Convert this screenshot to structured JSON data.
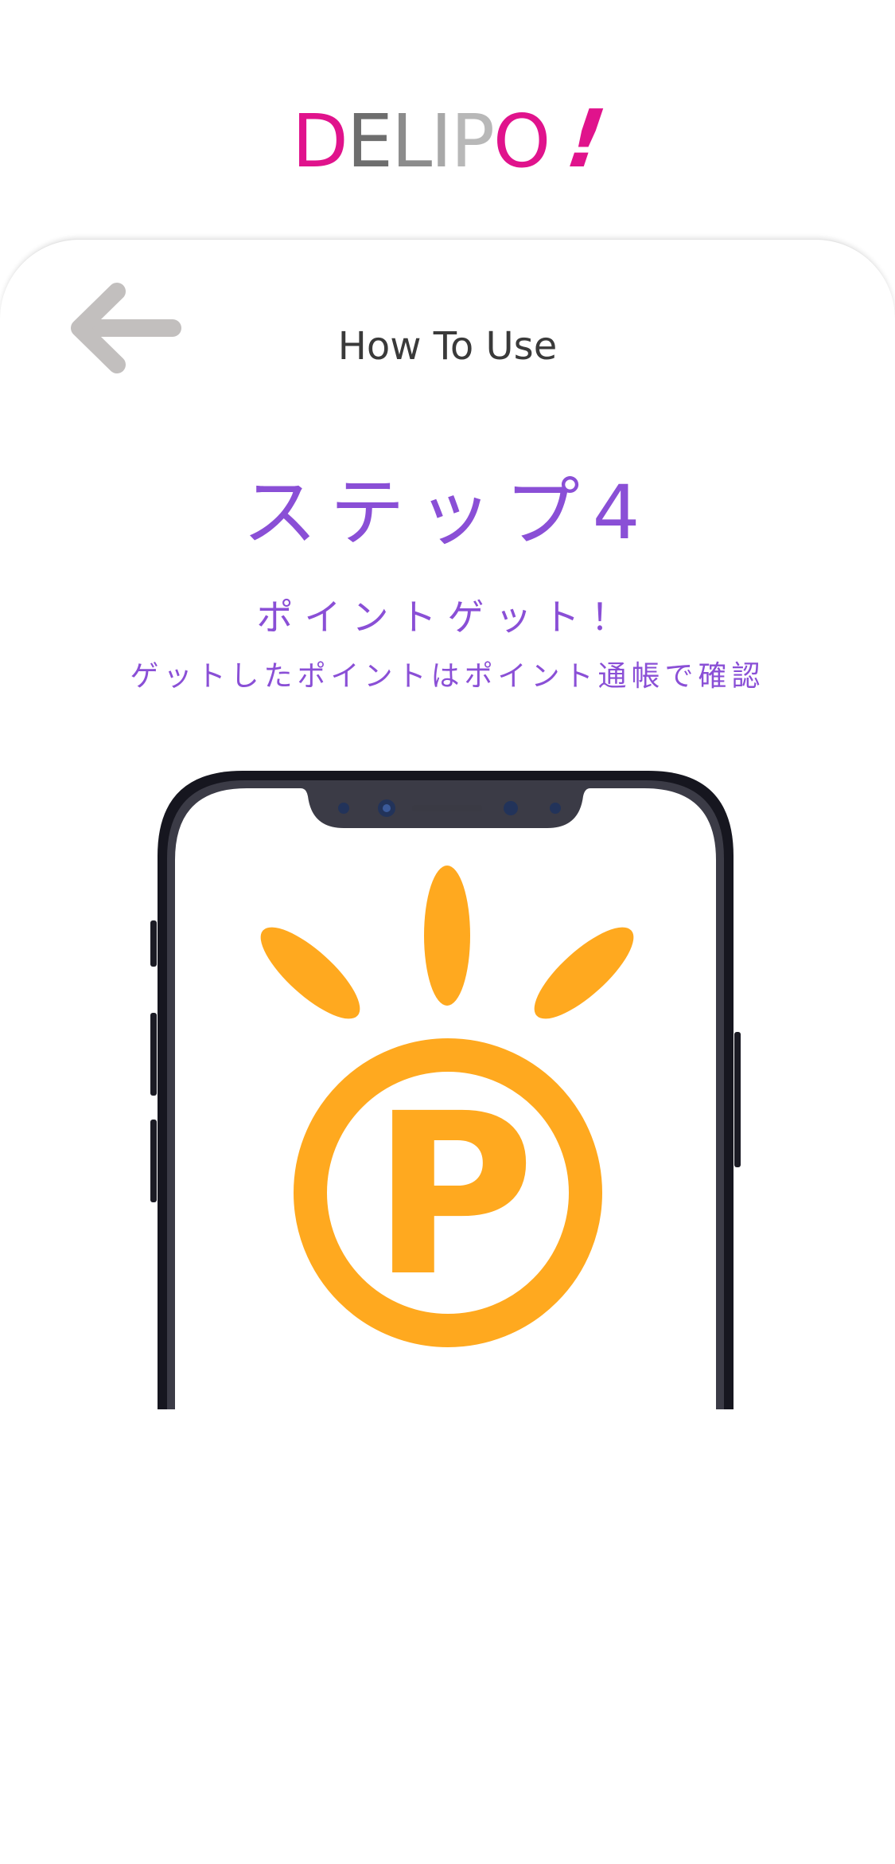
{
  "logo": {
    "letters": [
      {
        "char": "D",
        "color": "#e0138c"
      },
      {
        "char": "E",
        "color": "#6e6e6e"
      },
      {
        "char": "L",
        "color": "#8c8c8c"
      },
      {
        "char": "I",
        "color": "#a8a8a8"
      },
      {
        "char": "P",
        "color": "#b8b8b8"
      },
      {
        "char": "O",
        "color": "#e0138c"
      }
    ],
    "exclamation": "!",
    "exclamation_color": "#e0138c"
  },
  "header": {
    "back_icon": "arrow-left-icon",
    "title": "How To Use"
  },
  "step": {
    "title": "ステップ4",
    "subtitle": "ポイントゲット！",
    "description": "ゲットしたポイントはポイント通帳で確認",
    "accent_color": "#8a4fd6"
  },
  "illustration": {
    "icon": "point-coin-icon",
    "glyph": "P",
    "color": "#ffa91f",
    "device_icon": "smartphone-icon"
  }
}
